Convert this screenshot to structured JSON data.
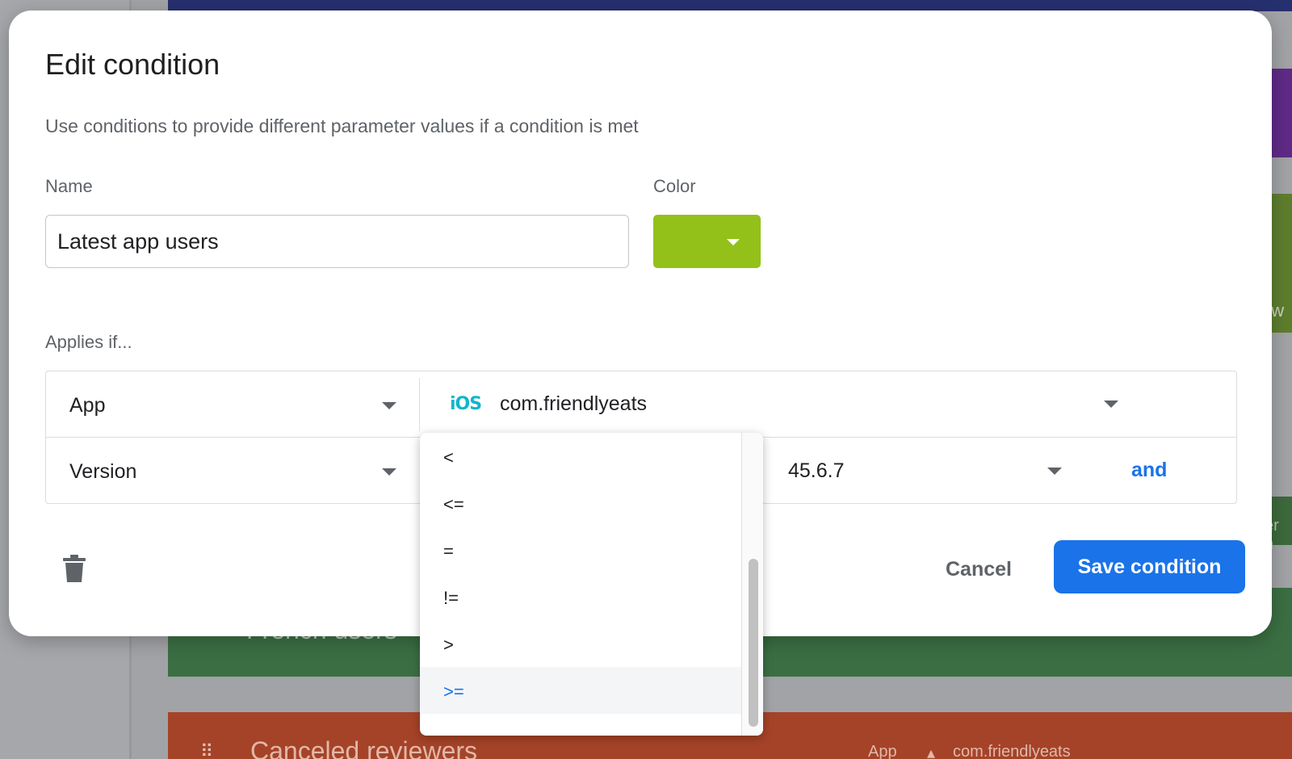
{
  "background": {
    "side_text_1": "ew",
    "side_text_2": "er n",
    "row_french": "French users",
    "row_canceled": "Canceled reviewers",
    "row_canceled_app_label": "App",
    "row_canceled_app_value": "com.friendlyeats"
  },
  "dialog": {
    "title": "Edit condition",
    "subtitle": "Use conditions to provide different parameter values if a condition is met",
    "name_label": "Name",
    "name_value": "Latest app users",
    "color_label": "Color",
    "color_value": "#93c11a",
    "applies_label": "Applies if...",
    "rows": [
      {
        "type": "App",
        "platform_icon": "iOS",
        "value": "com.friendlyeats"
      },
      {
        "type": "Version",
        "value": "45.6.7",
        "conjunction": "and"
      }
    ],
    "cancel_label": "Cancel",
    "save_label": "Save condition"
  },
  "operator_dropdown": {
    "options": [
      "<",
      "<=",
      "=",
      "!=",
      ">",
      ">="
    ],
    "selected": ">="
  },
  "colors": {
    "primary": "#1a73e8",
    "ios_icon": "#12b5cb",
    "selected_option_bg": "#f4f5f7"
  }
}
